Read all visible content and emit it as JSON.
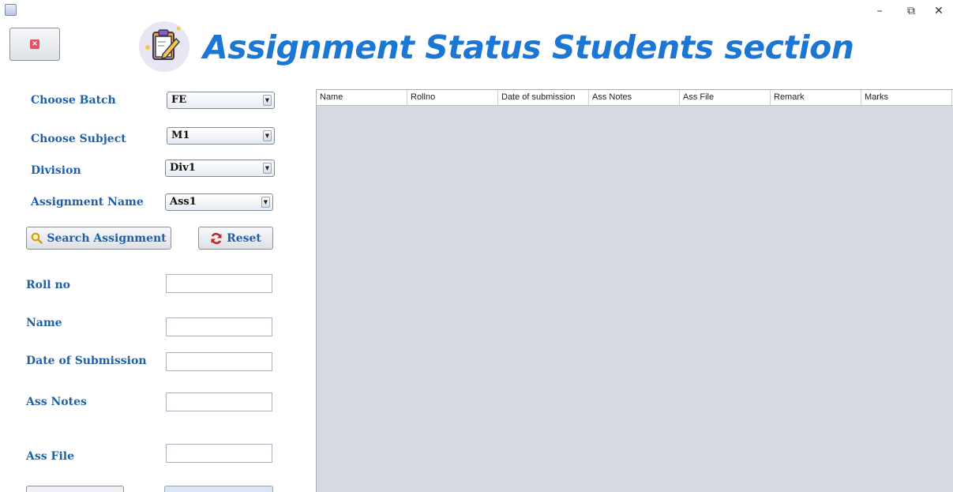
{
  "window": {
    "minimize_glyph": "–",
    "maximize_glyph": "⧉",
    "close_glyph": "✕"
  },
  "close_button": {
    "icon": "close-square-icon",
    "glyph": "×"
  },
  "header": {
    "title": "Assignment Status Students section",
    "icon": "clipboard-edit-icon"
  },
  "filters": {
    "batch": {
      "label": "Choose Batch",
      "value": "FE"
    },
    "subject": {
      "label": "Choose Subject",
      "value": "M1"
    },
    "division": {
      "label": "Division",
      "value": "Div1"
    },
    "assignment": {
      "label": "Assignment Name",
      "value": "Ass1"
    },
    "search_button": "Search Assignment",
    "reset_button": "Reset"
  },
  "form": {
    "roll_no": {
      "label": "Roll no",
      "value": ""
    },
    "name": {
      "label": "Name",
      "value": ""
    },
    "date": {
      "label": "Date of Submission",
      "value": ""
    },
    "notes": {
      "label": "Ass Notes",
      "value": ""
    },
    "file": {
      "label": "Ass File",
      "value": ""
    }
  },
  "table": {
    "columns": [
      "Name",
      "Rollno",
      "Date of submission",
      "Ass Notes",
      "Ass File",
      "Remark",
      "Marks"
    ],
    "rows": []
  },
  "colors": {
    "accent": "#1c76d4",
    "label": "#1f5fa8",
    "table_bg": "#d6d9df"
  }
}
